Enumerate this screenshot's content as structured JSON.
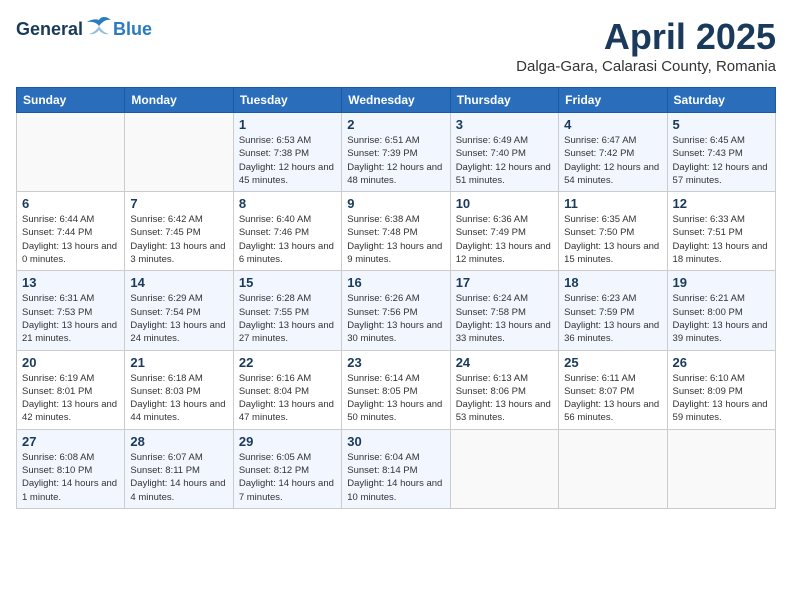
{
  "header": {
    "logo_general": "General",
    "logo_blue": "Blue",
    "month_title": "April 2025",
    "location": "Dalga-Gara, Calarasi County, Romania"
  },
  "days_of_week": [
    "Sunday",
    "Monday",
    "Tuesday",
    "Wednesday",
    "Thursday",
    "Friday",
    "Saturday"
  ],
  "weeks": [
    [
      {
        "day": "",
        "content": ""
      },
      {
        "day": "",
        "content": ""
      },
      {
        "day": "1",
        "content": "Sunrise: 6:53 AM\nSunset: 7:38 PM\nDaylight: 12 hours and 45 minutes."
      },
      {
        "day": "2",
        "content": "Sunrise: 6:51 AM\nSunset: 7:39 PM\nDaylight: 12 hours and 48 minutes."
      },
      {
        "day": "3",
        "content": "Sunrise: 6:49 AM\nSunset: 7:40 PM\nDaylight: 12 hours and 51 minutes."
      },
      {
        "day": "4",
        "content": "Sunrise: 6:47 AM\nSunset: 7:42 PM\nDaylight: 12 hours and 54 minutes."
      },
      {
        "day": "5",
        "content": "Sunrise: 6:45 AM\nSunset: 7:43 PM\nDaylight: 12 hours and 57 minutes."
      }
    ],
    [
      {
        "day": "6",
        "content": "Sunrise: 6:44 AM\nSunset: 7:44 PM\nDaylight: 13 hours and 0 minutes."
      },
      {
        "day": "7",
        "content": "Sunrise: 6:42 AM\nSunset: 7:45 PM\nDaylight: 13 hours and 3 minutes."
      },
      {
        "day": "8",
        "content": "Sunrise: 6:40 AM\nSunset: 7:46 PM\nDaylight: 13 hours and 6 minutes."
      },
      {
        "day": "9",
        "content": "Sunrise: 6:38 AM\nSunset: 7:48 PM\nDaylight: 13 hours and 9 minutes."
      },
      {
        "day": "10",
        "content": "Sunrise: 6:36 AM\nSunset: 7:49 PM\nDaylight: 13 hours and 12 minutes."
      },
      {
        "day": "11",
        "content": "Sunrise: 6:35 AM\nSunset: 7:50 PM\nDaylight: 13 hours and 15 minutes."
      },
      {
        "day": "12",
        "content": "Sunrise: 6:33 AM\nSunset: 7:51 PM\nDaylight: 13 hours and 18 minutes."
      }
    ],
    [
      {
        "day": "13",
        "content": "Sunrise: 6:31 AM\nSunset: 7:53 PM\nDaylight: 13 hours and 21 minutes."
      },
      {
        "day": "14",
        "content": "Sunrise: 6:29 AM\nSunset: 7:54 PM\nDaylight: 13 hours and 24 minutes."
      },
      {
        "day": "15",
        "content": "Sunrise: 6:28 AM\nSunset: 7:55 PM\nDaylight: 13 hours and 27 minutes."
      },
      {
        "day": "16",
        "content": "Sunrise: 6:26 AM\nSunset: 7:56 PM\nDaylight: 13 hours and 30 minutes."
      },
      {
        "day": "17",
        "content": "Sunrise: 6:24 AM\nSunset: 7:58 PM\nDaylight: 13 hours and 33 minutes."
      },
      {
        "day": "18",
        "content": "Sunrise: 6:23 AM\nSunset: 7:59 PM\nDaylight: 13 hours and 36 minutes."
      },
      {
        "day": "19",
        "content": "Sunrise: 6:21 AM\nSunset: 8:00 PM\nDaylight: 13 hours and 39 minutes."
      }
    ],
    [
      {
        "day": "20",
        "content": "Sunrise: 6:19 AM\nSunset: 8:01 PM\nDaylight: 13 hours and 42 minutes."
      },
      {
        "day": "21",
        "content": "Sunrise: 6:18 AM\nSunset: 8:03 PM\nDaylight: 13 hours and 44 minutes."
      },
      {
        "day": "22",
        "content": "Sunrise: 6:16 AM\nSunset: 8:04 PM\nDaylight: 13 hours and 47 minutes."
      },
      {
        "day": "23",
        "content": "Sunrise: 6:14 AM\nSunset: 8:05 PM\nDaylight: 13 hours and 50 minutes."
      },
      {
        "day": "24",
        "content": "Sunrise: 6:13 AM\nSunset: 8:06 PM\nDaylight: 13 hours and 53 minutes."
      },
      {
        "day": "25",
        "content": "Sunrise: 6:11 AM\nSunset: 8:07 PM\nDaylight: 13 hours and 56 minutes."
      },
      {
        "day": "26",
        "content": "Sunrise: 6:10 AM\nSunset: 8:09 PM\nDaylight: 13 hours and 59 minutes."
      }
    ],
    [
      {
        "day": "27",
        "content": "Sunrise: 6:08 AM\nSunset: 8:10 PM\nDaylight: 14 hours and 1 minute."
      },
      {
        "day": "28",
        "content": "Sunrise: 6:07 AM\nSunset: 8:11 PM\nDaylight: 14 hours and 4 minutes."
      },
      {
        "day": "29",
        "content": "Sunrise: 6:05 AM\nSunset: 8:12 PM\nDaylight: 14 hours and 7 minutes."
      },
      {
        "day": "30",
        "content": "Sunrise: 6:04 AM\nSunset: 8:14 PM\nDaylight: 14 hours and 10 minutes."
      },
      {
        "day": "",
        "content": ""
      },
      {
        "day": "",
        "content": ""
      },
      {
        "day": "",
        "content": ""
      }
    ]
  ]
}
